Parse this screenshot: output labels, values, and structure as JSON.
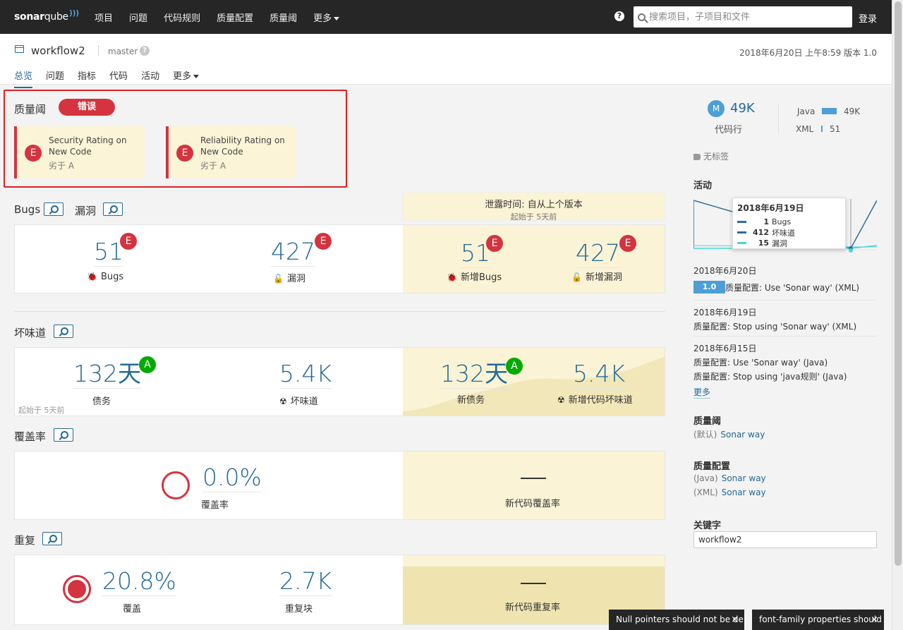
{
  "nav": {
    "logo_bold": "sonar",
    "logo_light": "qube",
    "items": [
      "项目",
      "问题",
      "代码规则",
      "质量配置",
      "质量阈",
      "更多"
    ],
    "help": "?",
    "search_placeholder": "搜索项目，子项目和文件",
    "login": "登录"
  },
  "project": {
    "name": "workflow2",
    "branch": "master",
    "meta": "2018年6月20日 上午8:59  版本 1.0",
    "tabs": [
      "总览",
      "问题",
      "指标",
      "代码",
      "活动",
      "更多"
    ]
  },
  "quality_gate": {
    "title": "质量阈",
    "status": "错误",
    "conditions": [
      {
        "rating": "E",
        "text": "Security Rating on New Code",
        "sub": "劣于 A"
      },
      {
        "rating": "E",
        "text": "Reliability Rating on New Code",
        "sub": "劣于 A"
      }
    ]
  },
  "leak_period": {
    "title": "泄露时间: 自从上个版本",
    "sub": "起始于 5天前"
  },
  "bugs_section": {
    "title_bugs": "Bugs",
    "title_vuln": "漏洞",
    "bugs": {
      "value": "51",
      "rating": "E",
      "label": "Bugs"
    },
    "vulns": {
      "value": "427",
      "rating": "E",
      "label": "漏洞"
    },
    "new_bugs": {
      "value": "51",
      "rating": "E",
      "label": "新增Bugs"
    },
    "new_vulns": {
      "value": "427",
      "rating": "E",
      "label": "新增漏洞"
    }
  },
  "smells_section": {
    "title": "坏味道",
    "debt": {
      "value": "132天",
      "rating": "A",
      "label": "债务"
    },
    "smells": {
      "value": "5.4K",
      "label": "坏味道"
    },
    "new_debt": {
      "value": "132天",
      "rating": "A",
      "label": "新债务"
    },
    "new_smells": {
      "value": "5.4K",
      "label": "新增代码坏味道"
    },
    "since": "起始于 5天前"
  },
  "coverage_section": {
    "title": "覆盖率",
    "value": "0.0%",
    "label": "覆盖率",
    "new_label": "新代码覆盖率"
  },
  "dup_section": {
    "title": "重复",
    "value": "20.8%",
    "label": "覆盖",
    "blocks": "2.7K",
    "blocks_label": "重复块",
    "new_label": "新代码重复率"
  },
  "sidebar": {
    "loc_badge": "M",
    "loc_value": "49K",
    "loc_label": "代码行",
    "langs": [
      {
        "name": "Java",
        "value": "49K"
      },
      {
        "name": "XML",
        "value": "51"
      }
    ],
    "tags": "无标签",
    "activity_title": "活动",
    "tooltip": {
      "date": "2018年6月19日",
      "rows": [
        {
          "num": "1",
          "label": "Bugs",
          "color": "#2c6f9e"
        },
        {
          "num": "412",
          "label": "坏味道",
          "color": "#2c6f9e"
        },
        {
          "num": "15",
          "label": "漏洞",
          "color": "#4bd5d5"
        }
      ]
    },
    "events": [
      {
        "date": "2018年6月20日",
        "version": "1.0",
        "lines": [
          "质量配置: Use 'Sonar way' (XML)"
        ]
      },
      {
        "date": "2018年6月19日",
        "lines": [
          "质量配置: Stop using 'Sonar way' (XML)"
        ]
      },
      {
        "date": "2018年6月15日",
        "lines": [
          "质量配置: Use 'Sonar way' (Java)",
          "质量配置: Stop using 'java规则' (Java)"
        ]
      }
    ],
    "more": "更多",
    "qg_title": "质量阈",
    "qg_default": "(默认)",
    "qg_link": "Sonar way",
    "qp_title": "质量配置",
    "qp_rows": [
      {
        "lang": "(Java)",
        "link": "Sonar way"
      },
      {
        "lang": "(XML)",
        "link": "Sonar way"
      }
    ],
    "kw_title": "关键字",
    "kw_value": "workflow2"
  },
  "toasts": [
    {
      "text": "Null pointers should not be de...",
      "close": "×"
    },
    {
      "text": "font-family properties should ...",
      "close": "×"
    }
  ]
}
